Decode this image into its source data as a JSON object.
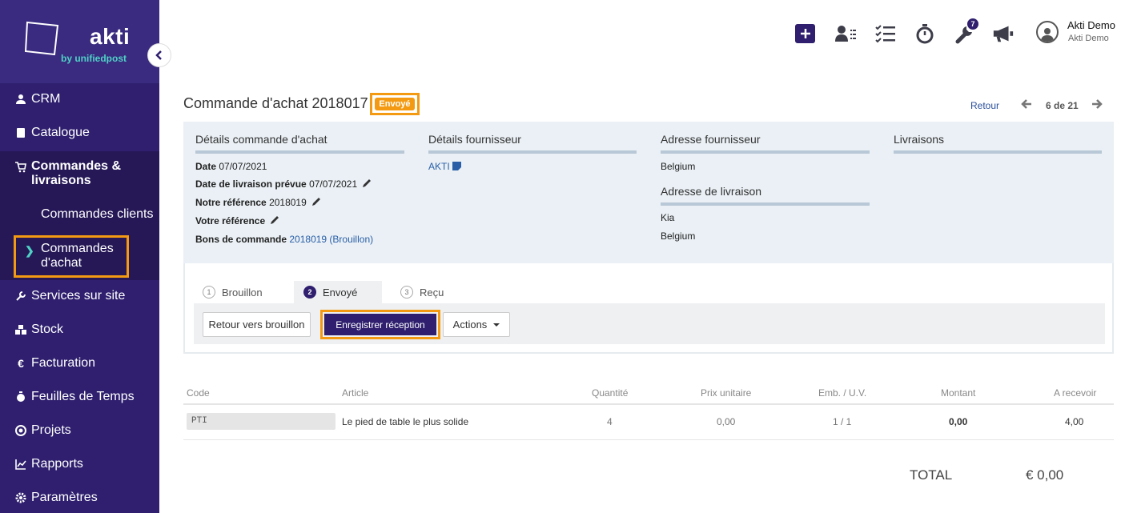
{
  "brand": {
    "name": "akti",
    "tagline": "by unifiedpost"
  },
  "sidebar": {
    "items": [
      {
        "label": "CRM",
        "icon": "person-icon"
      },
      {
        "label": "Catalogue",
        "icon": "book-icon"
      },
      {
        "label": "Commandes & livraisons",
        "icon": "cart-icon"
      },
      {
        "label": "Services sur site",
        "icon": "wrench-icon"
      },
      {
        "label": "Stock",
        "icon": "boxes-icon"
      },
      {
        "label": "Facturation",
        "icon": "euro-icon"
      },
      {
        "label": "Feuilles de Temps",
        "icon": "stopwatch-icon"
      },
      {
        "label": "Projets",
        "icon": "target-icon"
      },
      {
        "label": "Rapports",
        "icon": "chart-icon"
      },
      {
        "label": "Paramètres",
        "icon": "gear-icon"
      }
    ],
    "subitems": [
      {
        "label": "Commandes clients"
      },
      {
        "label": "Commandes d'achat",
        "active": true
      }
    ]
  },
  "topbar": {
    "notification_count": "7",
    "user_name": "Akti Demo",
    "user_company": "Akti Demo"
  },
  "header": {
    "title": "Commande d'achat 2018017",
    "status": "Envoyé",
    "back_label": "Retour",
    "pager": "6 de 21"
  },
  "details": {
    "order": {
      "title": "Détails commande d'achat",
      "date_label": "Date",
      "date_value": "07/07/2021",
      "delivery_label": "Date de livraison prévue",
      "delivery_value": "07/07/2021",
      "our_ref_label": "Notre référence",
      "our_ref_value": "2018019",
      "your_ref_label": "Votre référence",
      "po_label": "Bons de commande",
      "po_value": "2018019 (Brouillon)"
    },
    "supplier": {
      "title": "Détails fournisseur",
      "name": "AKTI"
    },
    "supplier_address": {
      "title": "Adresse fournisseur",
      "country": "Belgium"
    },
    "delivery_address": {
      "title": "Adresse de livraison",
      "line1": "Kia",
      "country": "Belgium"
    },
    "deliveries": {
      "title": "Livraisons"
    }
  },
  "workflow": {
    "steps": [
      {
        "num": "1",
        "label": "Brouillon"
      },
      {
        "num": "2",
        "label": "Envoyé",
        "active": true
      },
      {
        "num": "3",
        "label": "Reçu"
      }
    ],
    "btn_back_draft": "Retour vers brouillon",
    "btn_register": "Enregistrer réception",
    "btn_actions": "Actions"
  },
  "table": {
    "headers": [
      "Code",
      "Article",
      "Quantité",
      "Prix unitaire",
      "Emb. / U.V.",
      "Montant",
      "A recevoir"
    ],
    "rows": [
      {
        "code": "PTI",
        "article": "Le pied de table le plus solide",
        "qty": "4",
        "unit_price": "0,00",
        "pack": "1 / 1",
        "amount": "0,00",
        "to_receive": "4,00"
      }
    ]
  },
  "totals": {
    "label": "TOTAL",
    "value": "€ 0,00"
  },
  "colors": {
    "sidebar": "#2f1f6e",
    "accent": "#f39a12",
    "teal": "#4fd1c5",
    "link": "#2a5fa8"
  }
}
